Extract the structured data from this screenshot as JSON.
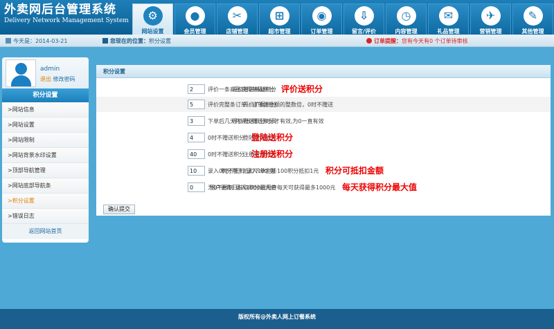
{
  "header": {
    "title_cn": "外卖网后台管理系统",
    "title_en": "Delivery Network Management System",
    "nav": [
      {
        "label": "网站设置",
        "icon": "gear-icon",
        "glyph": "⚙",
        "active": true
      },
      {
        "label": "会员管理",
        "icon": "user-icon",
        "glyph": "●",
        "active": false
      },
      {
        "label": "店铺管理",
        "icon": "tools-icon",
        "glyph": "✂",
        "active": false
      },
      {
        "label": "超市管理",
        "icon": "cart-icon",
        "glyph": "⊞",
        "active": false
      },
      {
        "label": "订单管理",
        "icon": "film-icon",
        "glyph": "◉",
        "active": false
      },
      {
        "label": "留言/评价",
        "icon": "download-icon",
        "glyph": "⇩",
        "active": false
      },
      {
        "label": "内容管理",
        "icon": "clock-icon",
        "glyph": "◷",
        "active": false
      },
      {
        "label": "礼品管理",
        "icon": "mail-icon",
        "glyph": "✉",
        "active": false
      },
      {
        "label": "营销管理",
        "icon": "plane-icon",
        "glyph": "✈",
        "active": false
      },
      {
        "label": "其他管理",
        "icon": "wrench-icon",
        "glyph": "✎",
        "active": false
      }
    ]
  },
  "infobar": {
    "today": "今天是：2014-03-21",
    "location_label": "您现在的位置：",
    "location_value": "积分设置",
    "reminder_label": "订单提醒：",
    "reminder_text": "您有今天有0 个订单待审核"
  },
  "sidebar": {
    "username": "admin",
    "logout": "退出",
    "change_password": "修改密码",
    "title": "积分设置",
    "items": [
      {
        "label": ">网站信息",
        "active": false
      },
      {
        "label": ">网站设置",
        "active": false
      },
      {
        "label": ">网站限制",
        "active": false
      },
      {
        "label": ">网站背景水印设置",
        "active": false
      },
      {
        "label": ">顶部导航管理",
        "active": false
      },
      {
        "label": ">网站底部导航条",
        "active": false
      },
      {
        "label": ">积分设置",
        "active": true
      },
      {
        "label": ">错误日志",
        "active": false
      }
    ],
    "footer_link": "返回网站首页"
  },
  "panel": {
    "title": "积分设置",
    "rows": [
      {
        "label": "评价赠送基础积分",
        "value": "2",
        "desc": "评价一条商品获得基础积分",
        "note": "评价送积分"
      },
      {
        "label": "评价扩展积分",
        "value": "5",
        "desc": "评价完整条订单，订单总金额的整数倍，0时不赠送",
        "note": ""
      },
      {
        "label": "评价赠送积分时间",
        "value": "3",
        "desc": "下单后几天内评价赠送积分才有效,为0一直有效",
        "note": ""
      },
      {
        "label": "登陆赠送积分",
        "value": "4",
        "desc": "0时不赠送积分",
        "note": "登陆送积分"
      },
      {
        "label": "注册赠送积分",
        "value": "40",
        "desc": "0时不赠送积分",
        "note": "注册送积分"
      },
      {
        "label": "积分用于抵扣下单金额",
        "value": "10",
        "desc": "录入0时不抵扣 录入100 则 100积分抵扣1元",
        "note": "积分可抵扣金额"
      },
      {
        "label": "用户更每日获取积分最大值",
        "value": "0",
        "desc": "为0不限制 录入1000则用户每天可获得最多1000元",
        "note": "每天获得积分最大值"
      }
    ],
    "submit_label": "确认提交"
  },
  "footer": {
    "text": "版权所有@外卖人网上订餐系统"
  },
  "colors": {
    "background": "#4ea9d6",
    "header": "#0b5f93",
    "note_red": "#e00000",
    "footer": "#1b5f8e"
  }
}
